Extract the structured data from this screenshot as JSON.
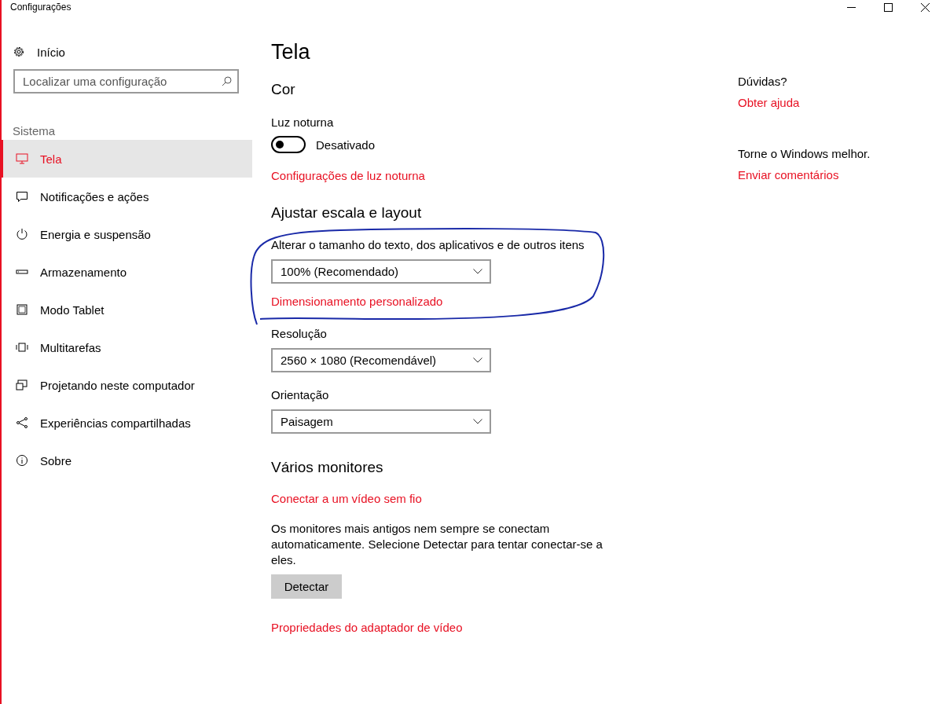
{
  "window": {
    "title": "Configurações"
  },
  "sidebar": {
    "home": "Início",
    "search": {
      "placeholder": "Localizar uma configuração"
    },
    "section": "Sistema",
    "items": [
      {
        "label": "Tela",
        "selected": true
      },
      {
        "label": "Notificações e ações",
        "selected": false
      },
      {
        "label": "Energia e suspensão",
        "selected": false
      },
      {
        "label": "Armazenamento",
        "selected": false
      },
      {
        "label": "Modo Tablet",
        "selected": false
      },
      {
        "label": "Multitarefas",
        "selected": false
      },
      {
        "label": "Projetando neste computador",
        "selected": false
      },
      {
        "label": "Experiências compartilhadas",
        "selected": false
      },
      {
        "label": "Sobre",
        "selected": false
      }
    ]
  },
  "main": {
    "title": "Tela",
    "color_heading": "Cor",
    "night_light": {
      "label": "Luz noturna",
      "on": false,
      "state_text": "Desativado"
    },
    "night_link": "Configurações de luz noturna",
    "scale_heading": "Ajustar escala e layout",
    "scale_label": "Alterar o tamanho do texto, dos aplicativos e de outros itens",
    "scale_value": "100% (Recomendado)",
    "custom_scale_link": "Dimensionamento personalizado",
    "resolution_label": "Resolução",
    "resolution_value": "2560 × 1080 (Recomendável)",
    "orientation_label": "Orientação",
    "orientation_value": "Paisagem",
    "monitors_heading": "Vários monitores",
    "wireless_link": "Conectar a um vídeo sem fio",
    "monitors_note": "Os monitores mais antigos nem sempre se conectam automaticamente. Selecione Detectar para tentar conectar-se a eles.",
    "detect_button": "Detectar",
    "adapter_link": "Propriedades do adaptador de vídeo"
  },
  "aside": {
    "help_heading": "Dúvidas?",
    "help_link": "Obter ajuda",
    "feedback_heading": "Torne o Windows melhor.",
    "feedback_link": "Enviar comentários"
  }
}
